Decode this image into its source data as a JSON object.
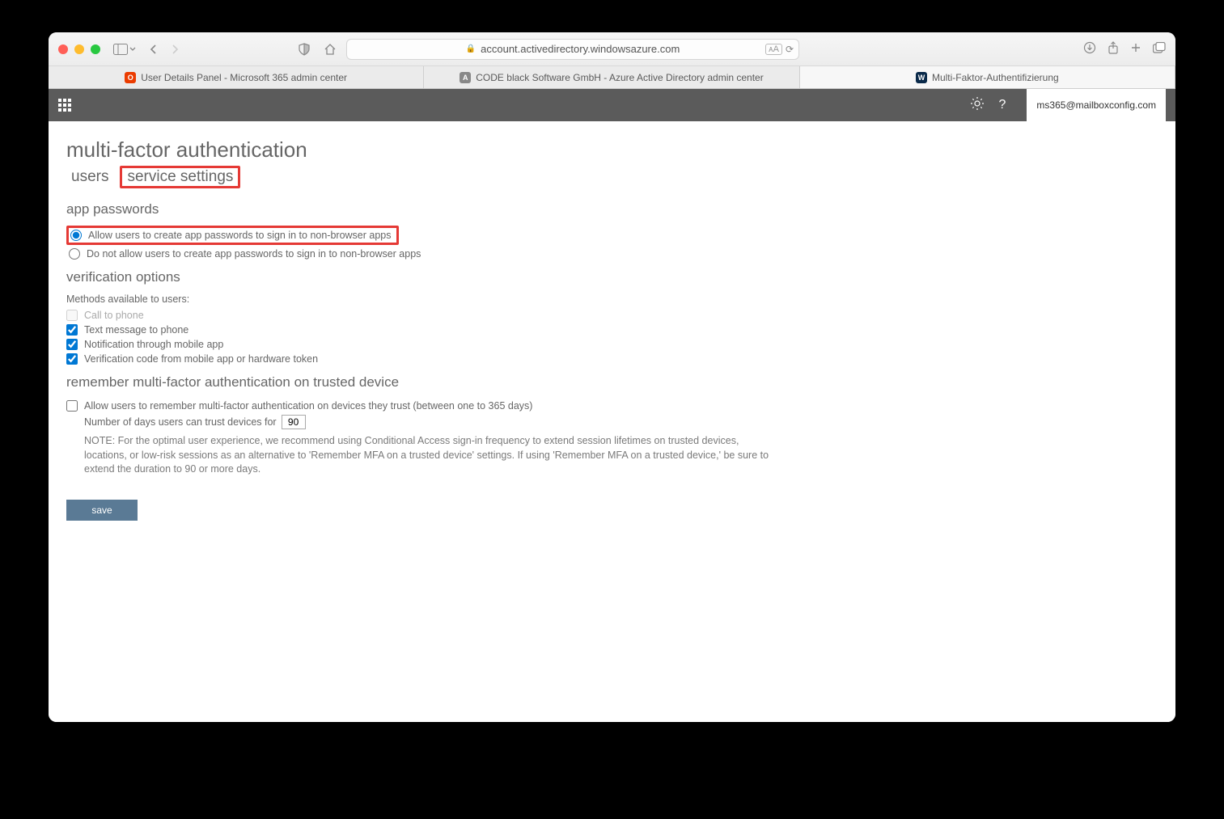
{
  "browser": {
    "url": "account.activedirectory.windowsazure.com",
    "tabs": [
      {
        "label": "User Details Panel - Microsoft 365 admin center",
        "favicon": "O",
        "favicon_class": "orange"
      },
      {
        "label": "CODE black Software GmbH - Azure Active Directory admin center",
        "favicon": "A",
        "favicon_class": "grey"
      },
      {
        "label": "Multi-Faktor-Authentifizierung",
        "favicon": "W",
        "favicon_class": "blue"
      }
    ]
  },
  "header": {
    "account": "ms365@mailboxconfig.com"
  },
  "page": {
    "title": "multi-factor authentication",
    "nav_tabs": {
      "users": "users",
      "service_settings": "service settings"
    },
    "sections": {
      "app_passwords": {
        "heading": "app passwords",
        "opt_allow": "Allow users to create app passwords to sign in to non-browser apps",
        "opt_deny": "Do not allow users to create app passwords to sign in to non-browser apps"
      },
      "verification": {
        "heading": "verification options",
        "methods_label": "Methods available to users:",
        "call": "Call to phone",
        "sms": "Text message to phone",
        "notify_app": "Notification through mobile app",
        "code_app": "Verification code from mobile app or hardware token"
      },
      "remember": {
        "heading": "remember multi-factor authentication on trusted device",
        "allow_label": "Allow users to remember multi-factor authentication on devices they trust (between one to 365 days)",
        "days_label": "Number of days users can trust devices for",
        "days_value": "90",
        "note": "NOTE: For the optimal user experience, we recommend using Conditional Access sign-in frequency to extend session lifetimes on trusted devices, locations, or low-risk sessions as an alternative to 'Remember MFA on a trusted device' settings. If using 'Remember MFA on a trusted device,' be sure to extend the duration to 90 or more days."
      }
    },
    "save_label": "save"
  }
}
